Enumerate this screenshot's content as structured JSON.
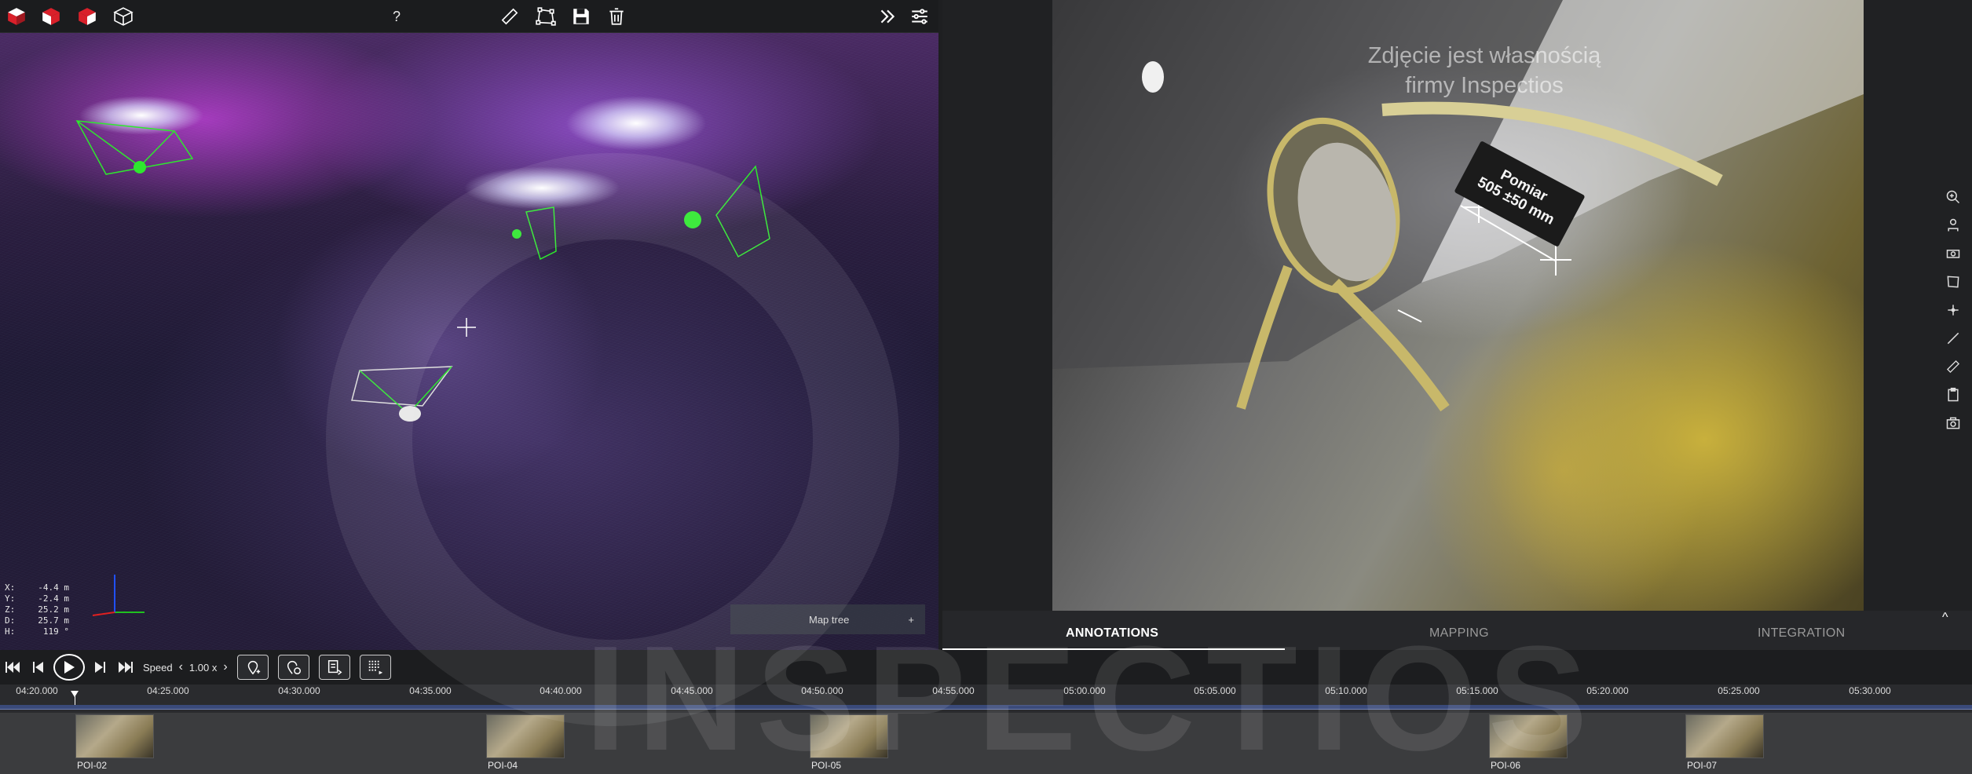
{
  "toolbar": {
    "help_label": "?",
    "icons": [
      "cube-red-icon",
      "cube-red-shaded-icon",
      "cube-red-alt-icon",
      "cube-outline-icon",
      "ruler-icon",
      "polygon-icon",
      "save-icon",
      "trash-icon",
      "double-chevron-right-icon",
      "settings-list-icon"
    ]
  },
  "viewport": {
    "coords": [
      {
        "k": "X:",
        "v": "-4.4 m"
      },
      {
        "k": "Y:",
        "v": "-2.4 m"
      },
      {
        "k": "Z:",
        "v": "25.2 m"
      },
      {
        "k": "D:",
        "v": "25.7 m"
      },
      {
        "k": "H:",
        "v": "119 °"
      }
    ],
    "map_tree": {
      "label": "Map tree",
      "plus": "+"
    }
  },
  "image": {
    "watermark_line1": "Zdjęcie jest własnością",
    "watermark_line2": "firmy Inspectios",
    "measure_title": "Pomiar",
    "measure_value": "505 ±50 mm"
  },
  "tabs": {
    "annotations": "ANNOTATIONS",
    "mapping": "MAPPING",
    "integration": "INTEGRATION",
    "collapse": "^"
  },
  "playback": {
    "speed_label": "Speed",
    "speed_value": "1.00 x"
  },
  "timeline": {
    "ticks": [
      "04:20.000",
      "04:25.000",
      "04:30.000",
      "04:35.000",
      "04:40.000",
      "04:45.000",
      "04:50.000",
      "04:55.000",
      "05:00.000",
      "05:05.000",
      "05:10.000",
      "05:15.000",
      "05:20.000",
      "05:25.000",
      "05:30.000"
    ],
    "pois": [
      "POI-02",
      "POI-04",
      "POI-05",
      "POI-06",
      "POI-07"
    ]
  },
  "brand": {
    "name": "INSPECTIOS"
  },
  "colors": {
    "accent_red": "#d9202a",
    "point_green": "#2ee82e",
    "track_blue": "#3a4a7a"
  }
}
